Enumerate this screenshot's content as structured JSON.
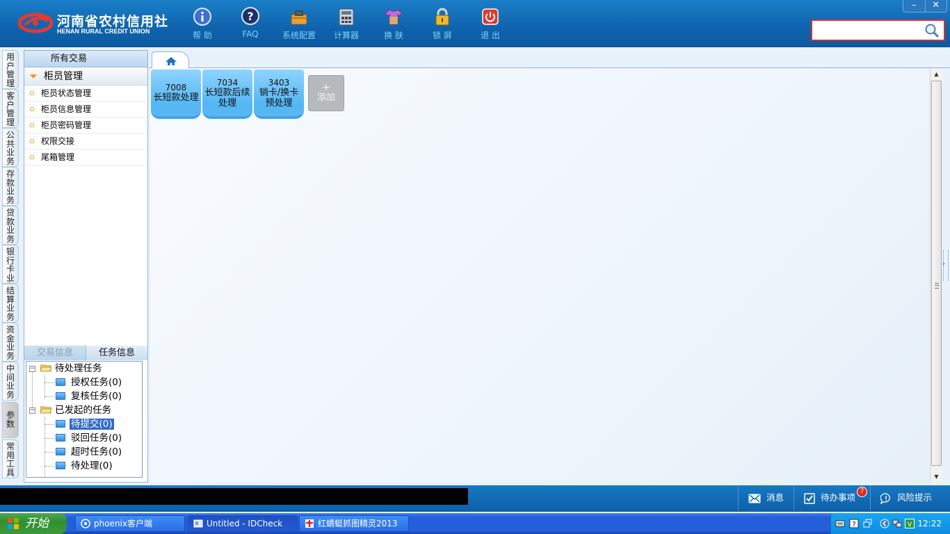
{
  "header": {
    "logo_cn": "河南省农村信用社",
    "logo_en": "HENAN RURAL CREDIT UNION",
    "tools": [
      {
        "label": "帮 助",
        "icon": "info-icon"
      },
      {
        "label": "FAQ",
        "icon": "question-icon"
      },
      {
        "label": "系统配置",
        "icon": "toolbox-icon"
      },
      {
        "label": "计算器",
        "icon": "calculator-icon"
      },
      {
        "label": "换 肤",
        "icon": "shirt-icon"
      },
      {
        "label": "锁 屏",
        "icon": "lock-icon"
      },
      {
        "label": "退 出",
        "icon": "power-icon"
      }
    ],
    "window": {
      "minimize": "–",
      "close": "✕"
    },
    "search": {
      "value": "",
      "placeholder": ""
    }
  },
  "vertical_nav": [
    {
      "label": "用户管理"
    },
    {
      "label": "客户管理"
    },
    {
      "label": "公共业务"
    },
    {
      "label": "存款业务"
    },
    {
      "label": "贷款业务"
    },
    {
      "label": "银行卡业务"
    },
    {
      "label": "结算业务"
    },
    {
      "label": "资金业务"
    },
    {
      "label": "中间业务"
    },
    {
      "label": "参数"
    },
    {
      "label": "常用工具"
    }
  ],
  "side_panel": {
    "title": "所有交易",
    "group": "柜员管理",
    "items": [
      {
        "label": "柜员状态管理"
      },
      {
        "label": "柜员信息管理"
      },
      {
        "label": "柜员密码管理"
      },
      {
        "label": "权限交接"
      },
      {
        "label": "尾箱管理"
      }
    ],
    "info_tabs": {
      "tab_transaction": "交易信息",
      "tab_task": "任务信息"
    },
    "tree": {
      "pending": {
        "label": "待处理任务",
        "children": [
          {
            "label": "授权任务(0)"
          },
          {
            "label": "复核任务(0)"
          }
        ]
      },
      "initiated": {
        "label": "已发起的任务",
        "children": [
          {
            "label": "待提交(0)"
          },
          {
            "label": "驳回任务(0)"
          },
          {
            "label": "超时任务(0)"
          },
          {
            "label": "待处理(0)"
          }
        ]
      }
    }
  },
  "tiles": [
    {
      "code": "7008",
      "name": "长短款处理"
    },
    {
      "code": "7034",
      "name": "长短款后续处理"
    },
    {
      "code": "3403",
      "name": "销卡/换卡预处理"
    }
  ],
  "add_tile": {
    "plus": "+",
    "label": "添加"
  },
  "statusbar": {
    "message": "",
    "messages": "消息",
    "todo": "待办事项",
    "todo_count": "7",
    "risk": "风险提示"
  },
  "taskbar": {
    "start": "开始",
    "tasks": [
      {
        "label": "phoenix客户端"
      },
      {
        "label": "Untitled - IDCheck"
      },
      {
        "label": "红蜻蜓抓图精灵2013"
      }
    ],
    "clock": "12:22"
  }
}
